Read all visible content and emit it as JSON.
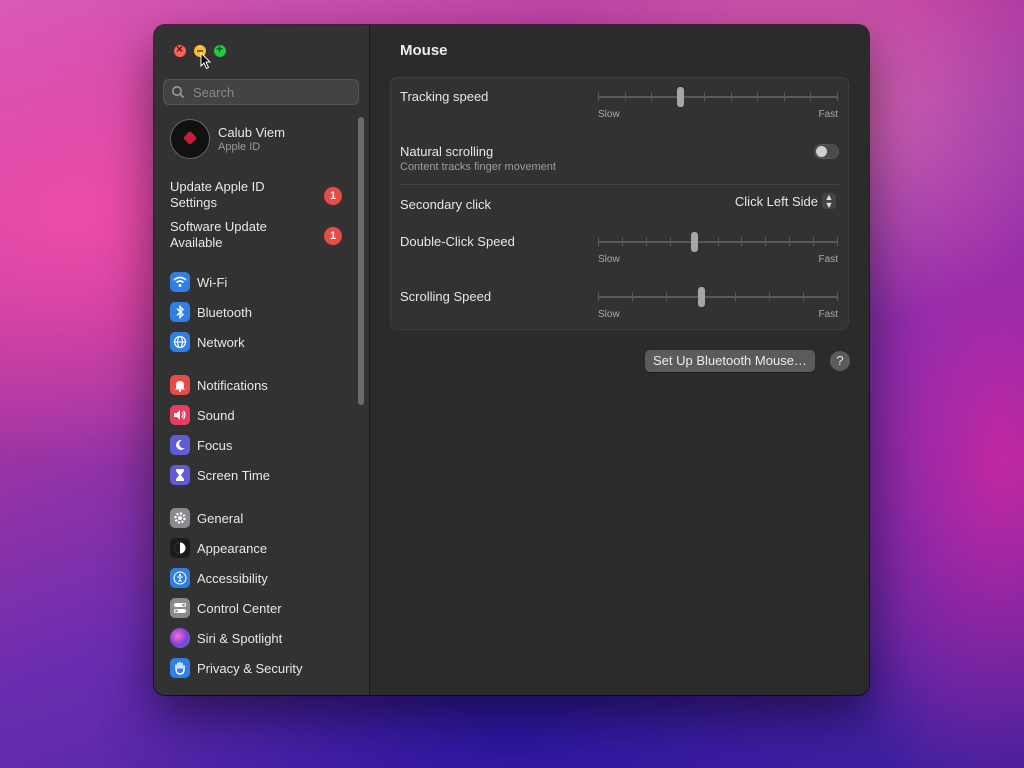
{
  "window": {
    "title": "Mouse"
  },
  "sidebar": {
    "search_placeholder": "Search",
    "profile": {
      "name": "Calub Viem",
      "subtitle": "Apple ID"
    },
    "alerts": [
      {
        "label": "Update Apple ID Settings",
        "badge": "1"
      },
      {
        "label": "Software Update Available",
        "badge": "1"
      }
    ],
    "items": [
      {
        "label": "Wi-Fi",
        "icon": "wifi-icon",
        "color": "#2f7fe4"
      },
      {
        "label": "Bluetooth",
        "icon": "bluetooth-icon",
        "color": "#2f7fe4"
      },
      {
        "label": "Network",
        "icon": "globe-icon",
        "color": "#2f7fe4"
      },
      {
        "label": "Notifications",
        "icon": "bell-icon",
        "color": "#ea4b48"
      },
      {
        "label": "Sound",
        "icon": "speaker-icon",
        "color": "#e83d63"
      },
      {
        "label": "Focus",
        "icon": "moon-icon",
        "color": "#5e5cd6"
      },
      {
        "label": "Screen Time",
        "icon": "hourglass-icon",
        "color": "#5e5cd6"
      },
      {
        "label": "General",
        "icon": "gear-icon",
        "color": "#8a8a8e"
      },
      {
        "label": "Appearance",
        "icon": "appearance-icon",
        "color": "#1c1c1c"
      },
      {
        "label": "Accessibility",
        "icon": "accessibility-icon",
        "color": "#2f7fe4"
      },
      {
        "label": "Control Center",
        "icon": "control-center-icon",
        "color": "#8a8a8e"
      },
      {
        "label": "Siri & Spotlight",
        "icon": "siri-icon",
        "color": "#7a3fd8"
      },
      {
        "label": "Privacy & Security",
        "icon": "hand-icon",
        "color": "#2f7fe4"
      }
    ]
  },
  "main": {
    "title": "Mouse",
    "tracking_speed": {
      "label": "Tracking speed",
      "slow": "Slow",
      "fast": "Fast",
      "value": 0.34,
      "ticks": 10
    },
    "natural_scrolling": {
      "label": "Natural scrolling",
      "sub": "Content tracks finger movement",
      "on": false
    },
    "secondary_click": {
      "label": "Secondary click",
      "value": "Click Left Side"
    },
    "double_click_speed": {
      "label": "Double-Click Speed",
      "slow": "Slow",
      "fast": "Fast",
      "value": 0.4,
      "ticks": 11
    },
    "scrolling_speed": {
      "label": "Scrolling Speed",
      "slow": "Slow",
      "fast": "Fast",
      "value": 0.43,
      "ticks": 8
    },
    "setup_button": "Set Up Bluetooth Mouse…",
    "help_button": "?"
  }
}
